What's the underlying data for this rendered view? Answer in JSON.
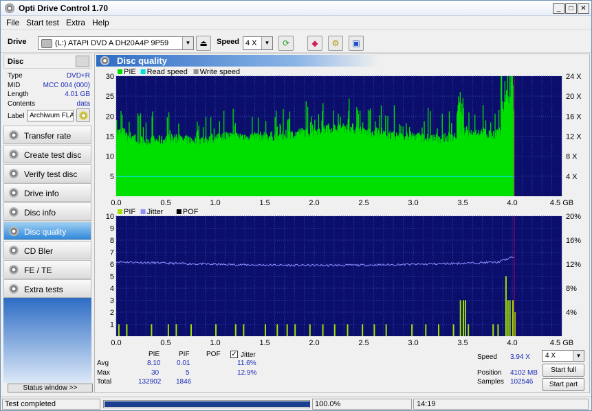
{
  "window": {
    "title": "Opti Drive Control 1.70"
  },
  "menu": [
    "File",
    "Start test",
    "Extra",
    "Help"
  ],
  "toolbar": {
    "drive_label": "Drive",
    "drive_value": "(L:)   ATAPI DVD A  DH20A4P 9P59",
    "speed_label": "Speed",
    "speed_value": "4 X"
  },
  "disc": {
    "header": "Disc",
    "rows": [
      {
        "k": "Type",
        "v": "DVD+R"
      },
      {
        "k": "MID",
        "v": "MCC 004 (000)"
      },
      {
        "k": "Length",
        "v": "4.01 GB"
      },
      {
        "k": "Contents",
        "v": "data"
      }
    ],
    "label_key": "Label",
    "label_value": "Archiwum FLA"
  },
  "nav": [
    {
      "label": "Transfer rate",
      "active": false
    },
    {
      "label": "Create test disc",
      "active": false
    },
    {
      "label": "Verify test disc",
      "active": false
    },
    {
      "label": "Drive info",
      "active": false
    },
    {
      "label": "Disc info",
      "active": false
    },
    {
      "label": "Disc quality",
      "active": true
    },
    {
      "label": "CD Bler",
      "active": false
    },
    {
      "label": "FE / TE",
      "active": false
    },
    {
      "label": "Extra tests",
      "active": false
    }
  ],
  "status_window": "Status window >>",
  "panel_title": "Disc quality",
  "chart_data": [
    {
      "type": "bar",
      "legend": [
        "PIE",
        "Read speed",
        "Write speed"
      ],
      "colors": {
        "pie": "#00e000",
        "read": "#00e0e0",
        "write": "#909090",
        "bg": "#0b0f6b",
        "grid": "#3040b0",
        "marker": "#c00060"
      },
      "xlim": [
        0,
        4.5
      ],
      "ylim": [
        0,
        30
      ],
      "xticks": [
        "0.0",
        "0.5",
        "1.0",
        "1.5",
        "2.0",
        "2.5",
        "3.0",
        "3.5",
        "4.0",
        "4.5 GB"
      ],
      "yticks": [
        "5",
        "10",
        "15",
        "20",
        "25",
        "30"
      ],
      "y2ticks": [
        "4 X",
        "8 X",
        "12 X",
        "16 X",
        "20 X",
        "24 X"
      ],
      "pie_base": [
        16,
        15,
        14,
        14,
        14,
        14.5,
        14,
        14,
        14,
        14,
        14.5,
        15,
        15,
        15,
        15,
        15,
        15,
        15,
        15.5,
        16,
        16,
        16.5,
        17,
        17,
        17,
        16.5,
        16,
        16,
        15.5,
        15,
        15,
        15,
        14.5,
        14.5,
        14.5,
        15,
        16,
        16,
        16,
        15.5,
        16,
        16
      ],
      "read_speed": 3.94,
      "marker_x": 4.02
    },
    {
      "type": "bar",
      "legend": [
        "PIF",
        "Jitter",
        "POF"
      ],
      "colors": {
        "pif": "#a0e000",
        "jitter": "#9090ff",
        "pof": "#000000",
        "bg": "#0b0f6b",
        "grid": "#3040b0"
      },
      "xlim": [
        0,
        4.5
      ],
      "ylim": [
        0,
        10
      ],
      "xticks": [
        "0.0",
        "0.5",
        "1.0",
        "1.5",
        "2.0",
        "2.5",
        "3.0",
        "3.5",
        "4.0",
        "4.5 GB"
      ],
      "yticks": [
        "1",
        "2",
        "3",
        "4",
        "5",
        "6",
        "7",
        "8",
        "9",
        "10"
      ],
      "y2ticks": [
        "4%",
        "8%",
        "12%",
        "16%",
        "20%"
      ],
      "jitter_avg": 11.6,
      "pif_spikes": [
        [
          0.02,
          1
        ],
        [
          0.1,
          1
        ],
        [
          0.35,
          1
        ],
        [
          0.52,
          1
        ],
        [
          0.6,
          1
        ],
        [
          0.75,
          1
        ],
        [
          1.0,
          1
        ],
        [
          1.2,
          1
        ],
        [
          1.28,
          1
        ],
        [
          1.5,
          1
        ],
        [
          1.62,
          1
        ],
        [
          1.72,
          1
        ],
        [
          1.8,
          1
        ],
        [
          1.95,
          1
        ],
        [
          2.08,
          1
        ],
        [
          2.2,
          1
        ],
        [
          2.33,
          1
        ],
        [
          2.48,
          1
        ],
        [
          2.6,
          1
        ],
        [
          2.72,
          1
        ],
        [
          2.98,
          1
        ],
        [
          3.12,
          1
        ],
        [
          3.25,
          1
        ],
        [
          3.4,
          1
        ],
        [
          3.47,
          3
        ],
        [
          3.5,
          3
        ],
        [
          3.52,
          3
        ],
        [
          3.55,
          1
        ],
        [
          3.8,
          1
        ],
        [
          3.85,
          1
        ],
        [
          3.93,
          5
        ],
        [
          3.95,
          3
        ],
        [
          3.97,
          3
        ],
        [
          4.0,
          3
        ],
        [
          4.02,
          2
        ]
      ]
    }
  ],
  "stats": {
    "col_pie": "PIE",
    "col_pif": "PIF",
    "col_pof": "POF",
    "col_jitter": "Jitter",
    "avg_label": "Avg",
    "max_label": "Max",
    "total_label": "Total",
    "avg_pie": "8.10",
    "avg_pif": "0.01",
    "avg_jitter": "11.6%",
    "max_pie": "30",
    "max_pif": "5",
    "max_jitter": "12.9%",
    "total_pie": "132902",
    "total_pif": "1846",
    "speed_label": "Speed",
    "speed_value": "3.94 X",
    "position_label": "Position",
    "position_value": "4102 MB",
    "samples_label": "Samples",
    "samples_value": "102546",
    "speed_select": "4 X",
    "start_full": "Start full",
    "start_part": "Start part"
  },
  "statusbar": {
    "status": "Test completed",
    "progress_text": "100.0%",
    "progress": 1.0,
    "time": "14:19"
  }
}
